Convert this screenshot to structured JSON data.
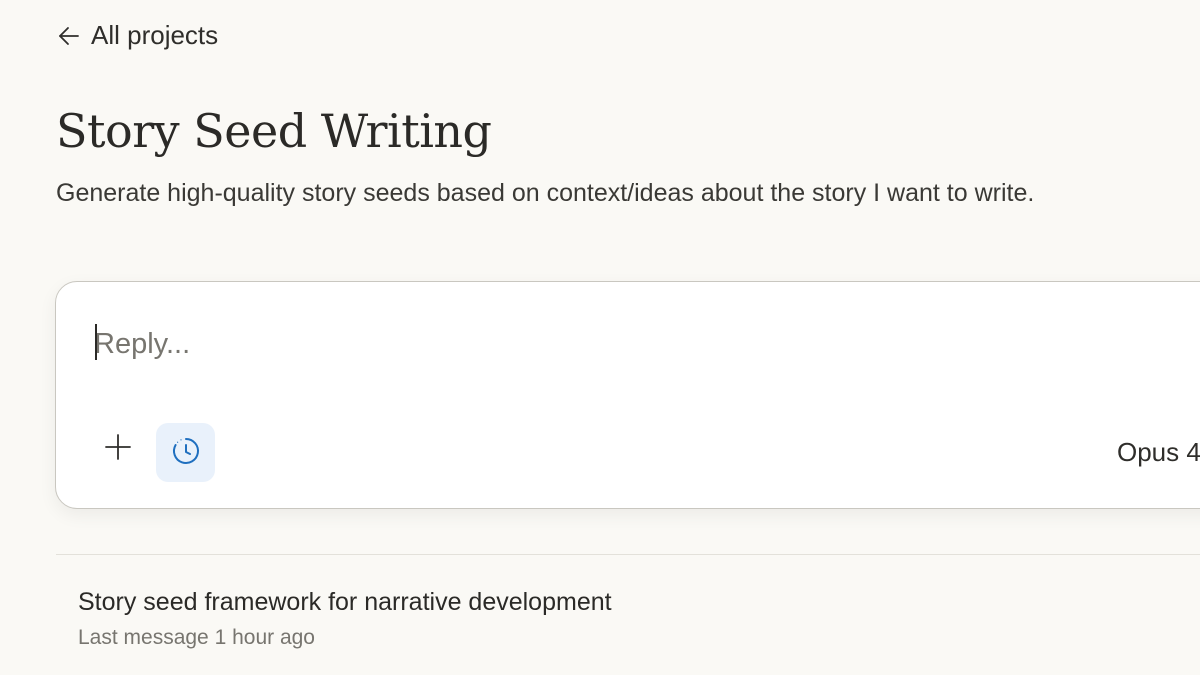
{
  "nav": {
    "back_label": "All projects",
    "back_icon": "arrow-left-icon"
  },
  "project": {
    "title": "Story Seed Writing",
    "description": "Generate high-quality story seeds based on context/ideas about the story I want to write."
  },
  "composer": {
    "placeholder": "Reply...",
    "value": "",
    "add_icon": "plus-icon",
    "history_icon": "clock-history-icon",
    "model_label": "Opus 4",
    "accent_color": "#1f6fbf"
  },
  "chats": [
    {
      "title": "Story seed framework for narrative development",
      "meta": "Last message 1 hour ago"
    }
  ]
}
